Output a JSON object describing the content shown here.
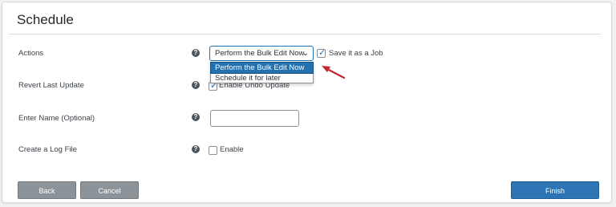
{
  "page": {
    "title": "Schedule"
  },
  "rows": {
    "actions": {
      "label": "Actions",
      "help": "?",
      "select_value": "Perform the Bulk Edit Now",
      "save_job_label": "Save it as a Job",
      "save_job_checked": true
    },
    "revert": {
      "label": "Revert Last Update",
      "help": "?",
      "checkbox_label": "Enable Undo Update",
      "checked": true
    },
    "name": {
      "label": "Enter Name (Optional)",
      "help": "?",
      "value": ""
    },
    "log": {
      "label": "Create a Log File",
      "help": "?",
      "checkbox_label": "Enable",
      "checked": false
    }
  },
  "dropdown": {
    "options": [
      "Perform the Bulk Edit Now",
      "Schedule it for later"
    ],
    "selected_index": 0
  },
  "buttons": {
    "back": "Back",
    "cancel": "Cancel",
    "finish": "Finish"
  },
  "colors": {
    "accent": "#2271b1",
    "button_gray": "#8c9399",
    "arrow": "#c0282d"
  }
}
